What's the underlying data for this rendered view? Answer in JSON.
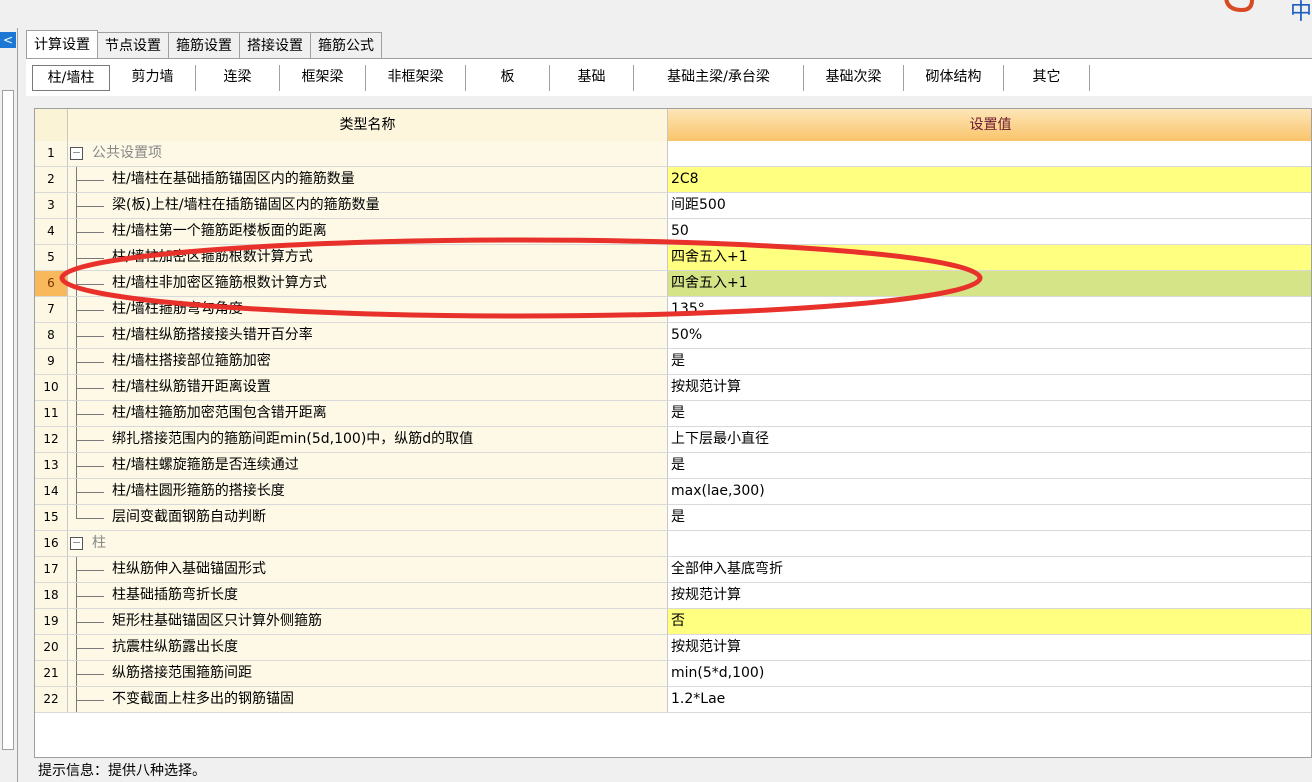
{
  "logo": {
    "text": "中",
    "icon": "app-logo-icon",
    "color": "#d84a24"
  },
  "collapse": {
    "glyph": "<"
  },
  "tabs_primary": [
    {
      "label": "计算设置",
      "active": true
    },
    {
      "label": "节点设置",
      "active": false
    },
    {
      "label": "箍筋设置",
      "active": false
    },
    {
      "label": "搭接设置",
      "active": false
    },
    {
      "label": "箍筋公式",
      "active": false
    }
  ],
  "tabs_secondary": [
    {
      "label": "柱/墙柱",
      "active": true
    },
    {
      "label": "剪力墙",
      "active": false
    },
    {
      "label": "连梁",
      "active": false
    },
    {
      "label": "框架梁",
      "active": false
    },
    {
      "label": "非框架梁",
      "active": false
    },
    {
      "label": "板",
      "active": false
    },
    {
      "label": "基础",
      "active": false
    },
    {
      "label": "基础主梁/承台梁",
      "active": false
    },
    {
      "label": "基础次梁",
      "active": false
    },
    {
      "label": "砌体结构",
      "active": false
    },
    {
      "label": "其它",
      "active": false
    }
  ],
  "table": {
    "header_name": "类型名称",
    "header_value": "设置值",
    "rows": [
      {
        "num": "1",
        "name": "公共设置项",
        "value": "",
        "group": true,
        "hl": ""
      },
      {
        "num": "2",
        "name": "柱/墙柱在基础插筋锚固区内的箍筋数量",
        "value": "2C8",
        "hl": "yellow"
      },
      {
        "num": "3",
        "name": "梁(板)上柱/墙柱在插筋锚固区内的箍筋数量",
        "value": "间距500",
        "hl": ""
      },
      {
        "num": "4",
        "name": "柱/墙柱第一个箍筋距楼板面的距离",
        "value": "50",
        "hl": ""
      },
      {
        "num": "5",
        "name": "柱/墙柱加密区箍筋根数计算方式",
        "value": "四舍五入+1",
        "hl": "yellow"
      },
      {
        "num": "6",
        "name": "柱/墙柱非加密区箍筋根数计算方式",
        "value": "四舍五入+1",
        "hl": "green",
        "selected": true
      },
      {
        "num": "7",
        "name": "柱/墙柱箍筋弯勾角度",
        "value": "135°",
        "hl": ""
      },
      {
        "num": "8",
        "name": "柱/墙柱纵筋搭接接头错开百分率",
        "value": "50%",
        "hl": ""
      },
      {
        "num": "9",
        "name": "柱/墙柱搭接部位箍筋加密",
        "value": "是",
        "hl": ""
      },
      {
        "num": "10",
        "name": "柱/墙柱纵筋错开距离设置",
        "value": "按规范计算",
        "hl": ""
      },
      {
        "num": "11",
        "name": "柱/墙柱箍筋加密范围包含错开距离",
        "value": "是",
        "hl": ""
      },
      {
        "num": "12",
        "name": "绑扎搭接范围内的箍筋间距min(5d,100)中，纵筋d的取值",
        "value": "上下层最小直径",
        "hl": ""
      },
      {
        "num": "13",
        "name": "柱/墙柱螺旋箍筋是否连续通过",
        "value": "是",
        "hl": ""
      },
      {
        "num": "14",
        "name": "柱/墙柱圆形箍筋的搭接长度",
        "value": "max(lae,300)",
        "hl": ""
      },
      {
        "num": "15",
        "name": "层间变截面钢筋自动判断",
        "value": "是",
        "hl": "",
        "last": true
      },
      {
        "num": "16",
        "name": "柱",
        "value": "",
        "group": true,
        "hl": ""
      },
      {
        "num": "17",
        "name": "柱纵筋伸入基础锚固形式",
        "value": "全部伸入基底弯折",
        "hl": ""
      },
      {
        "num": "18",
        "name": "柱基础插筋弯折长度",
        "value": "按规范计算",
        "hl": ""
      },
      {
        "num": "19",
        "name": "矩形柱基础锚固区只计算外侧箍筋",
        "value": "否",
        "hl": "yellow"
      },
      {
        "num": "20",
        "name": "抗震柱纵筋露出长度",
        "value": "按规范计算",
        "hl": ""
      },
      {
        "num": "21",
        "name": "纵筋搭接范围箍筋间距",
        "value": "min(5*d,100)",
        "hl": ""
      },
      {
        "num": "22",
        "name": "不变截面上柱多出的钢筋锚固",
        "value": "1.2*Lae",
        "hl": ""
      }
    ]
  },
  "status": {
    "text": "提示信息：提供八种选择。"
  },
  "annotation": {
    "stroke": "#e8312a"
  }
}
